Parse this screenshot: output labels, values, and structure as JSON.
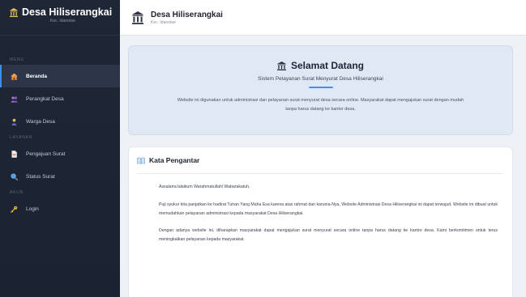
{
  "sidebar": {
    "brand_title": "Desa Hiliserangkai",
    "brand_subtitle": "Kec. Idanotae",
    "sections": [
      {
        "title": "MENU",
        "items": [
          {
            "label": "Beranda",
            "icon": "home-icon"
          },
          {
            "label": "Perangkat Desa",
            "icon": "users-icon"
          },
          {
            "label": "Warga Desa",
            "icon": "user-icon"
          }
        ]
      },
      {
        "title": "LAYANAN",
        "items": [
          {
            "label": "Pengajuan Surat",
            "icon": "document-icon"
          },
          {
            "label": "Status Surat",
            "icon": "search-icon"
          }
        ]
      },
      {
        "title": "AKUN",
        "items": [
          {
            "label": "Login",
            "icon": "key-icon"
          }
        ]
      }
    ],
    "active_item": "Beranda"
  },
  "header": {
    "title": "Desa Hiliserangkai",
    "subtitle": "Kec. Idanotae"
  },
  "welcome": {
    "title": "Selamat Datang",
    "subtitle": "Sistem Pelayanan Surat Menyurat Desa Hiliserangkai",
    "description": "Website ini digunakan untuk administrasi dan pelayanan surat menyurat desa secara online. Masyarakat dapat mengajukan surat dengan mudah tanpa harus datang ke kantor desa."
  },
  "foreword": {
    "title": "Kata Pengantar",
    "paragraphs": [
      "Assalamu'alaikum Warahmatullahi Wabarakatuh,",
      "Puji syukur kita panjatkan ke hadirat Tuhan Yang Maha Esa karena atas rahmat dan karunia-Nya, Website Administrasi Desa Hiliserangkai ini dapat terwujud. Website ini dibuat untuk memudahkan pelayanan administrasi kepada masyarakat Desa Hiliserangkai.",
      "Dengan adanya website ini, diharapkan masyarakat dapat mengajukan surat menyurat secara online tanpa harus datang ke kantor desa. Kami berkomitmen untuk terus meningkatkan pelayanan kepada masyarakat."
    ]
  },
  "colors": {
    "sidebar_bg": "#1f2737",
    "accent": "#3a8ff0",
    "welcome_bg": "#e0e8f3"
  }
}
